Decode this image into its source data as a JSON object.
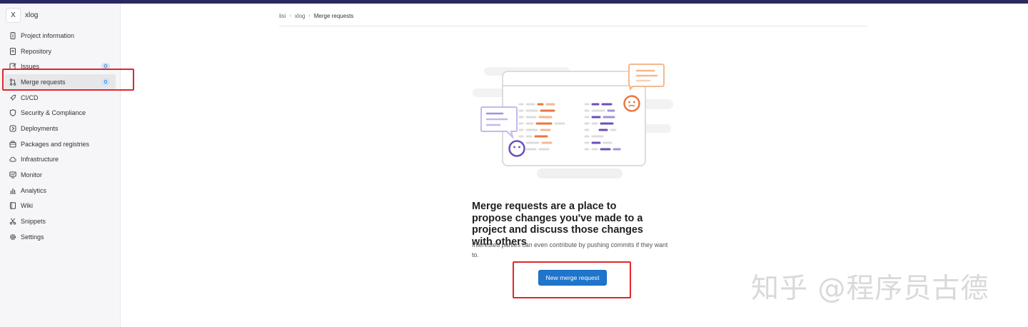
{
  "project": {
    "avatar_letter": "X",
    "name": "xlog"
  },
  "sidebar": {
    "items": [
      {
        "label": "Project information",
        "icon": "info-icon"
      },
      {
        "label": "Repository",
        "icon": "doc-icon"
      },
      {
        "label": "Issues",
        "icon": "issues-icon",
        "badge": "0"
      },
      {
        "label": "Merge requests",
        "icon": "merge-request-icon",
        "badge": "0",
        "active": true
      },
      {
        "label": "CI/CD",
        "icon": "rocket-icon"
      },
      {
        "label": "Security & Compliance",
        "icon": "shield-icon"
      },
      {
        "label": "Deployments",
        "icon": "deployments-icon"
      },
      {
        "label": "Packages and registries",
        "icon": "package-icon"
      },
      {
        "label": "Infrastructure",
        "icon": "cloud-icon"
      },
      {
        "label": "Monitor",
        "icon": "monitor-icon"
      },
      {
        "label": "Analytics",
        "icon": "chart-icon"
      },
      {
        "label": "Wiki",
        "icon": "book-icon"
      },
      {
        "label": "Snippets",
        "icon": "scissors-icon"
      },
      {
        "label": "Settings",
        "icon": "gear-icon"
      }
    ]
  },
  "breadcrumb": {
    "items": [
      "lisi",
      "xlog",
      "Merge requests"
    ]
  },
  "empty_state": {
    "title": "Merge requests are a place to propose changes you've made to a project and discuss those changes with others",
    "description": "Interested parties can even contribute by pushing commits if they want to.",
    "button_label": "New merge request"
  },
  "watermark": "知乎 @程序员古德",
  "colors": {
    "accent": "#1f75cb",
    "highlight": "#e0262b",
    "topbar": "#292961",
    "orange": "#e9773d",
    "purple": "#6b4fbb"
  }
}
